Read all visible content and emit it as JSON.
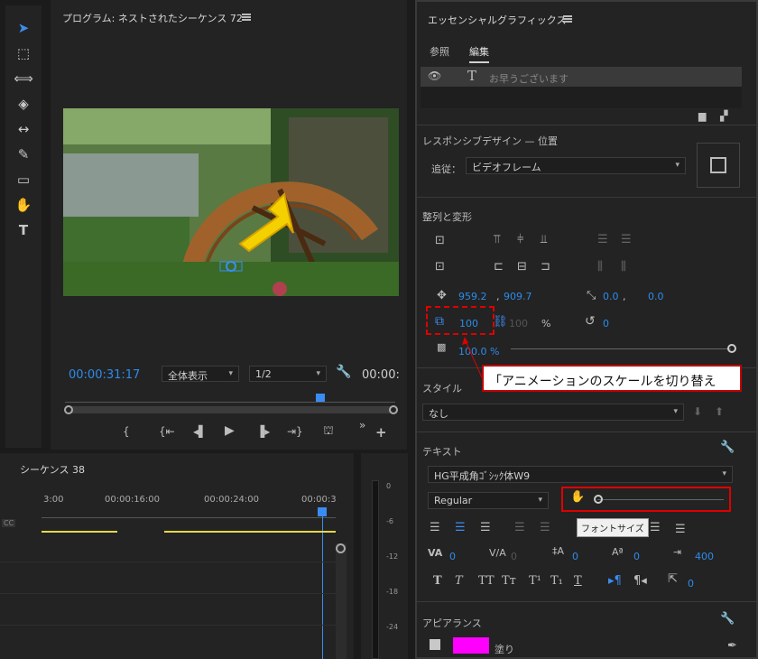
{
  "program": {
    "title": "プログラム: ネストされたシーケンス 72",
    "timecode_left": "00:00:31:17",
    "zoom": "全体表示",
    "resolution": "1/2",
    "timecode_right": "00:00:"
  },
  "timeline": {
    "title": "シーケンス 38",
    "rulers": [
      "3:00",
      "00:00:16:00",
      "00:00:24:00",
      "00:00:3"
    ],
    "cc_label": "CC",
    "meter_labels": [
      "0",
      "-6",
      "-12",
      "-18",
      "-24"
    ]
  },
  "essential_graphics": {
    "title": "エッセンシャルグラフィックス",
    "tab_browse": "参照",
    "tab_edit": "編集",
    "layer_text": "お早うございます",
    "responsive_header": "レスポンシブデザイン — 位置",
    "follow_label": "追従：",
    "follow_value": "ビデオフレーム",
    "align_header": "整列と変形",
    "pos_x": "959.2",
    "pos_y": "909.7",
    "anchor_x": "0.0",
    "anchor_y": "0.0",
    "scale": "100",
    "scale_h": "100",
    "scale_unit": "%",
    "rotation": "0",
    "opacity": "100.0 %",
    "style_header": "スタイル",
    "style_value": "なし",
    "text_header": "テキスト",
    "font": "HG平成角ｺﾞｼｯｸ体W9",
    "font_style": "Regular",
    "tooltip": "フォントサイズ",
    "tracking": "0",
    "kerning": "0",
    "leading": "0",
    "baseline": "0",
    "tsume": "400",
    "tab_width": "0",
    "appearance_header": "アピアランス",
    "fill_label": "塗り",
    "fill_color": "#ff00ff"
  },
  "annotation": {
    "callout": "「アニメーションのスケールを切り替え",
    "highlight_color": "#e00000"
  }
}
